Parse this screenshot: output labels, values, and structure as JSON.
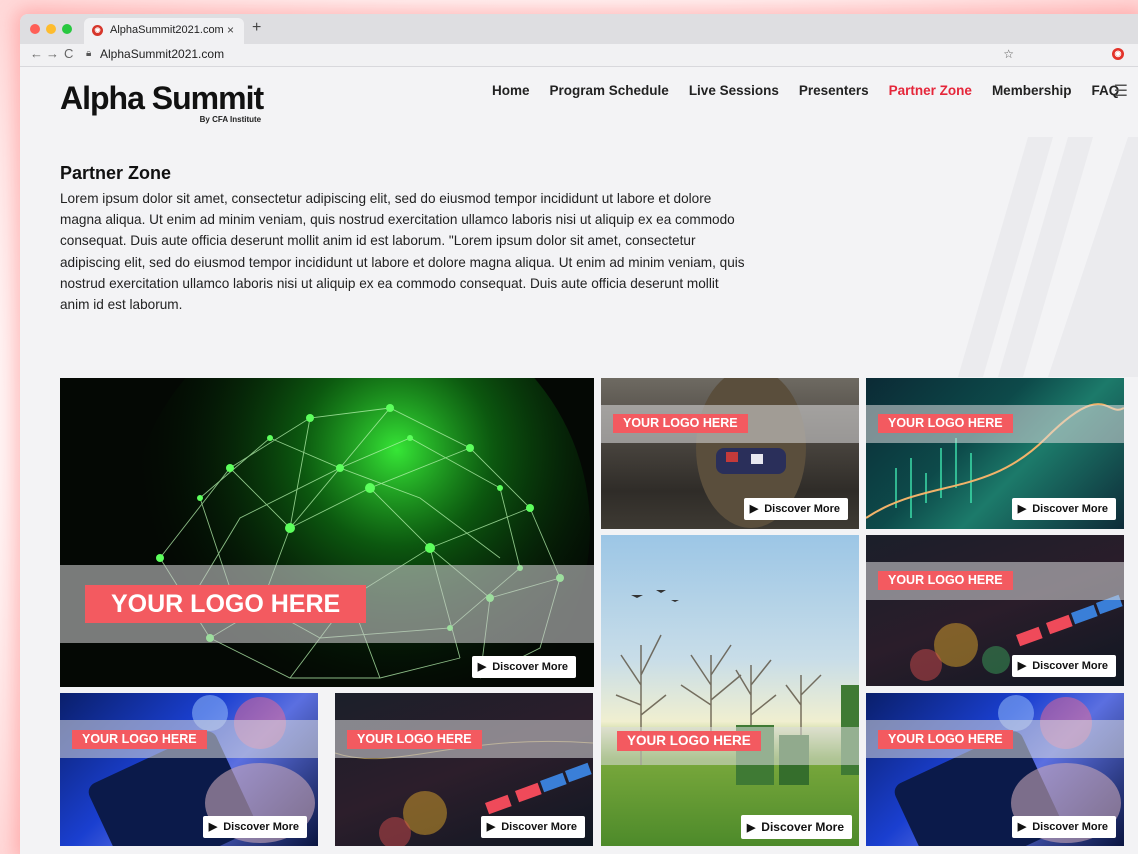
{
  "browser": {
    "tab_title": "AlphaSummit2021.com",
    "tab_close": "×",
    "new_tab": "+",
    "url": "AlphaSummit2021.com",
    "back": "←",
    "forward": "→",
    "reload": "C",
    "bookmark": "☆"
  },
  "site": {
    "logo_text": "Alpha Summit",
    "logo_sub": "By CFA Institute",
    "nav": [
      "Home",
      "Program Schedule",
      "Live Sessions",
      "Presenters",
      "Partner Zone",
      "Membership",
      "FAQ"
    ],
    "active_nav": "Partner Zone",
    "accent_color": "#e5263a"
  },
  "partner_zone": {
    "title": "Partner Zone",
    "body": "Lorem ipsum dolor sit amet, consectetur adipiscing elit, sed do eiusmod tempor incididunt ut labore et dolore magna aliqua. Ut enim ad minim veniam, quis nostrud exercitation ullamco laboris nisi ut aliquip ex ea commodo consequat. Duis aute officia deserunt mollit anim id est laborum. \"Lorem ipsum dolor sit amet, consectetur adipiscing elit, sed do eiusmod tempor incididunt ut labore et dolore magna aliqua. Ut enim ad minim veniam, quis nostrud exercitation ullamco laboris nisi ut aliquip ex ea commodo consequat. Duis aute officia deserunt mollit anim id est laborum."
  },
  "tiles": {
    "logo_label": "YOUR LOGO HERE",
    "discover_label": "Discover More",
    "badge_color": "#f35a60"
  }
}
